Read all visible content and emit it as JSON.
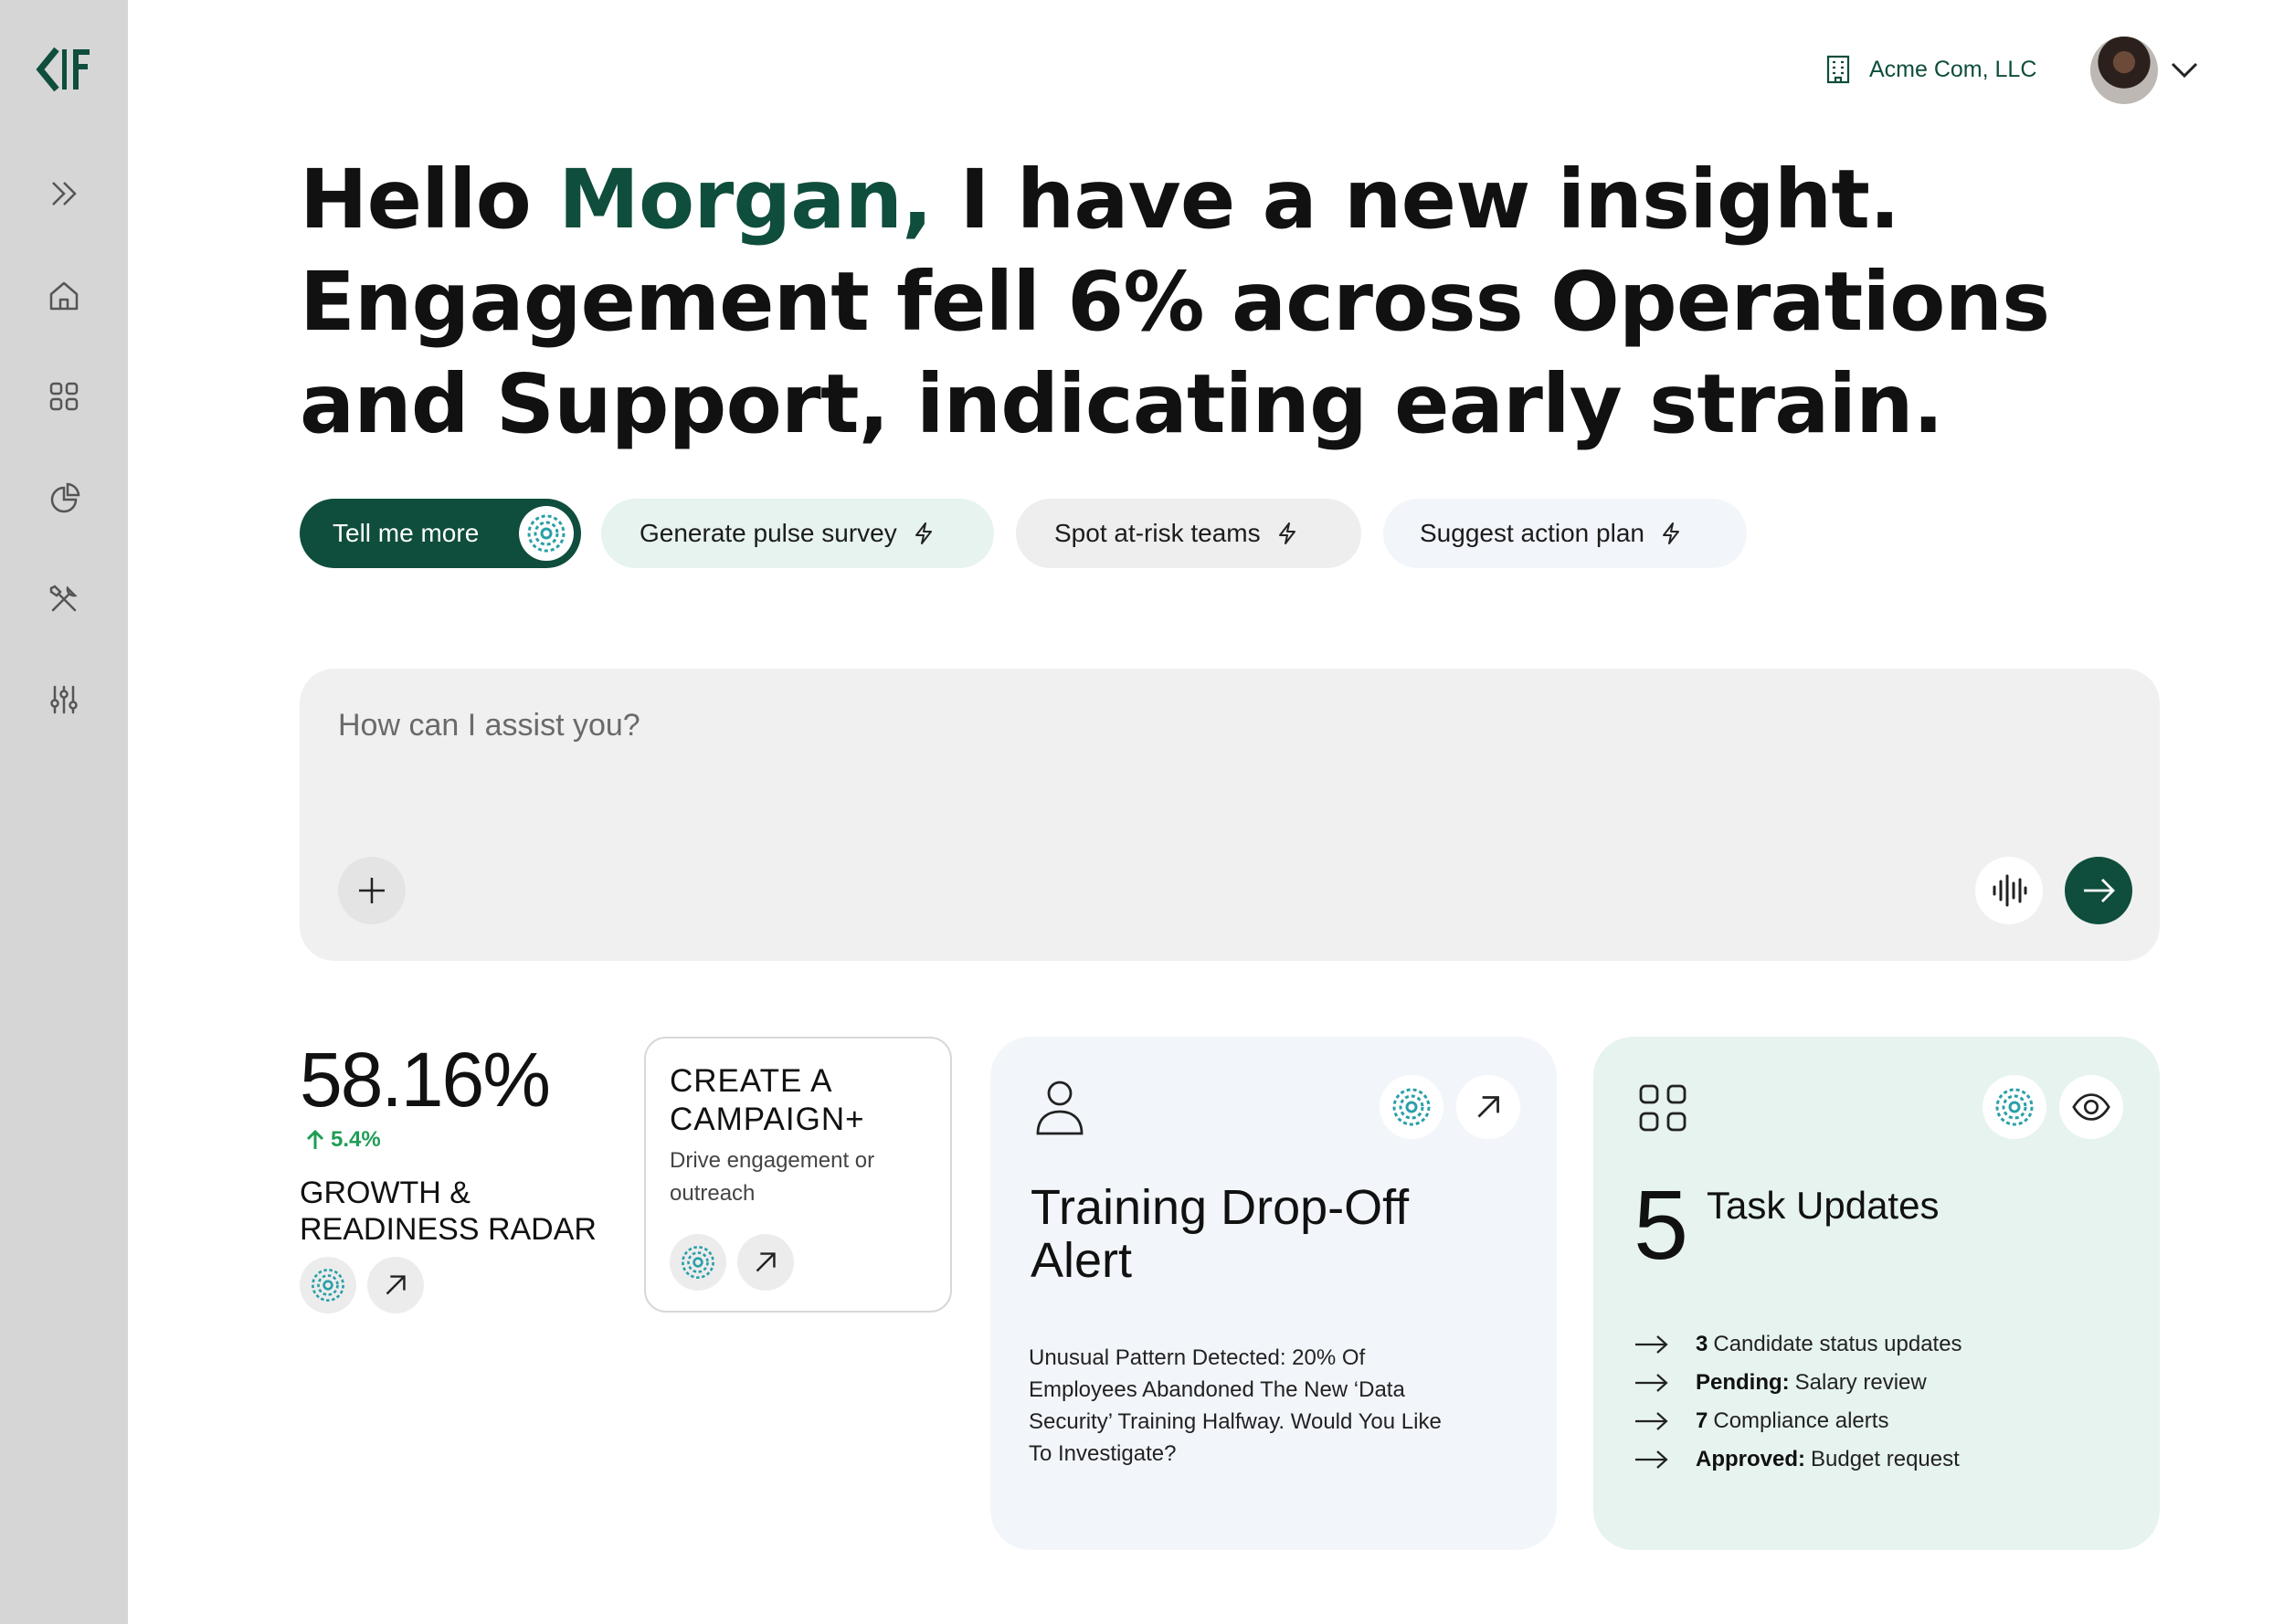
{
  "company": {
    "name": "Acme Com, LLC"
  },
  "headline": {
    "greeting": "Hello ",
    "name": "Morgan,",
    "rest": " I have a new insight. Engagement fell 6% across Operations and Support, indicating early strain."
  },
  "chips": {
    "primary": "Tell me more",
    "second": "Generate pulse survey",
    "third": "Spot at-risk teams",
    "fourth": "Suggest action plan"
  },
  "assistant": {
    "placeholder": "How can I assist you?"
  },
  "stat": {
    "value": "58.16%",
    "change": "5.4%",
    "label": "GROWTH & READINESS RADAR"
  },
  "campaign": {
    "title": "CREATE A CAMPAIGN+",
    "description": "Drive engagement or outreach"
  },
  "training": {
    "title": "Training Drop-Off Alert",
    "body": "Unusual Pattern Detected: 20% Of Employees Abandoned The New ‘Data Security’ Training Halfway. Would You Like To Investigate?"
  },
  "tasks": {
    "count": "5",
    "label": "Task Updates",
    "items": [
      {
        "bold": "3",
        "text": "Candidate status updates"
      },
      {
        "bold": "Pending:",
        "text": "Salary review"
      },
      {
        "bold": "7",
        "text": "Compliance alerts"
      },
      {
        "bold": "Approved:",
        "text": "Budget request"
      }
    ]
  },
  "colors": {
    "brand": "#0f4d3c",
    "sidebar": "#d6d6d6",
    "positive": "#1f9d55",
    "mint_card": "#e6f3ee",
    "blue_card": "#f2f6fb",
    "ai_orb": "#2a9fa8"
  },
  "icons": {
    "sidebar": [
      "logo-icon",
      "expand-icon",
      "home-icon",
      "grid-icon",
      "pie-chart-icon",
      "tools-icon",
      "sliders-icon"
    ]
  }
}
